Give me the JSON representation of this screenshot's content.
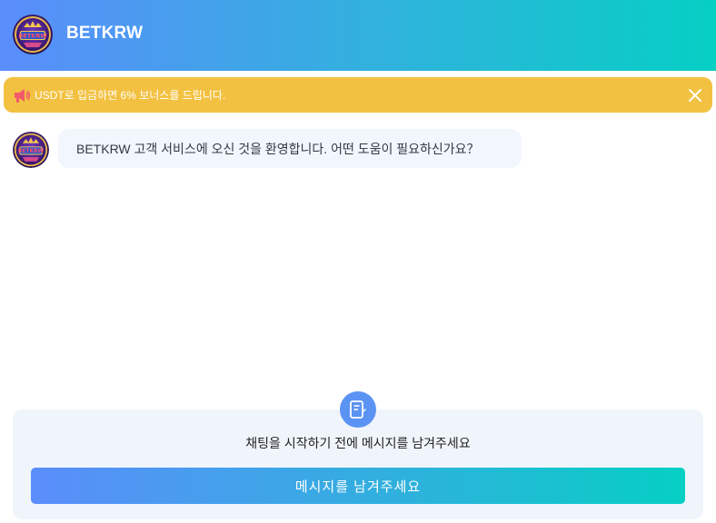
{
  "header": {
    "title": "BETKRW",
    "logo_text": "BETKRW"
  },
  "notice": {
    "text": "USDT로 입금하면 6% 보너스를 드립니다.",
    "icon": "megaphone-icon"
  },
  "chat": {
    "messages": [
      {
        "sender": "agent",
        "text": "BETKRW 고객 서비스에 오신 것을 환영합니다. 어떤 도움이 필요하신가요？"
      }
    ]
  },
  "compose": {
    "prompt": "채팅을 시작하기 전에 메시지를 남겨주세요",
    "button_label": "메시지를 남겨주세요",
    "icon": "message-form-icon"
  },
  "colors": {
    "header_gradient_start": "#5b8dfb",
    "header_gradient_end": "#06cfc4",
    "notice_bg": "#f3c141",
    "bubble_bg": "#f2f6fd",
    "compose_bg": "#f0f5fc",
    "compose_icon_bg": "#5b93f4"
  }
}
